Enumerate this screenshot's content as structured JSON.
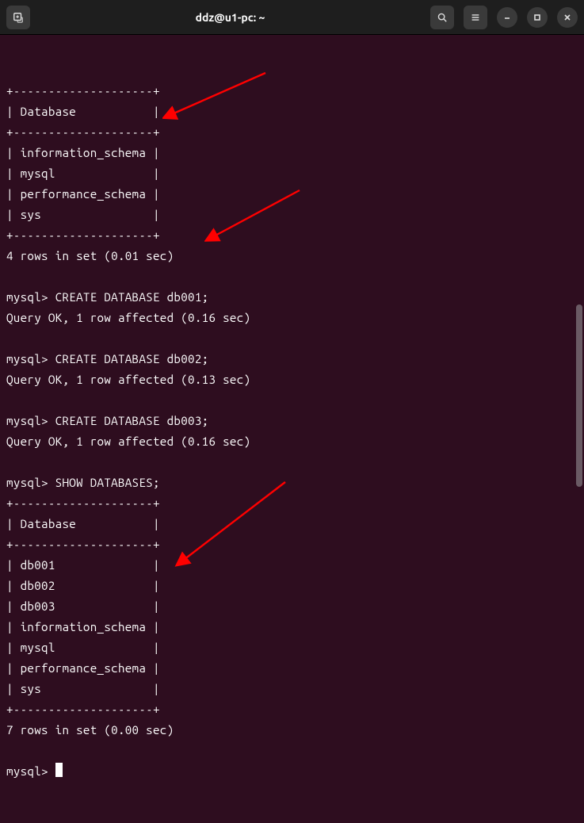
{
  "window": {
    "title": "ddz@u1-pc: ~"
  },
  "terminal": {
    "lines": [
      "+--------------------+",
      "| Database           |",
      "+--------------------+",
      "| information_schema |",
      "| mysql              |",
      "| performance_schema |",
      "| sys                |",
      "+--------------------+",
      "4 rows in set (0.01 sec)",
      "",
      "mysql> CREATE DATABASE db001;",
      "Query OK, 1 row affected (0.16 sec)",
      "",
      "mysql> CREATE DATABASE db002;",
      "Query OK, 1 row affected (0.13 sec)",
      "",
      "mysql> CREATE DATABASE db003;",
      "Query OK, 1 row affected (0.16 sec)",
      "",
      "mysql> SHOW DATABASES;",
      "+--------------------+",
      "| Database           |",
      "+--------------------+",
      "| db001              |",
      "| db002              |",
      "| db003              |",
      "| information_schema |",
      "| mysql              |",
      "| performance_schema |",
      "| sys                |",
      "+--------------------+",
      "7 rows in set (0.00 sec)",
      "",
      "mysql> "
    ],
    "prompt": "mysql>",
    "cursor_after_last": true
  },
  "annotations": {
    "arrow_color": "#ff0000"
  }
}
